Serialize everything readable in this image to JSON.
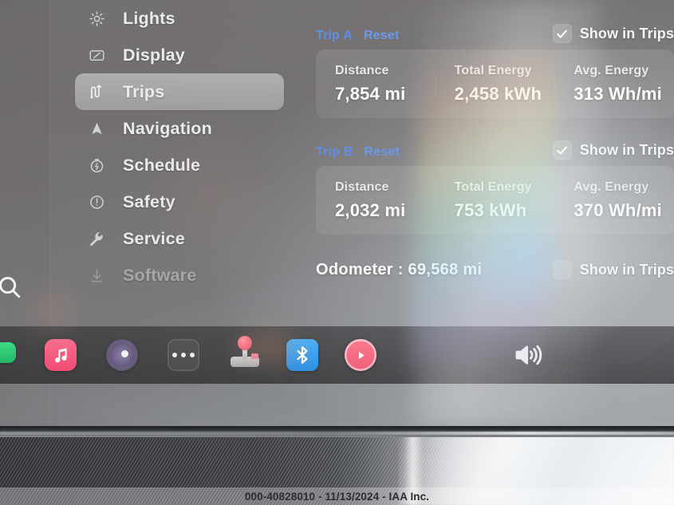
{
  "sidebar": {
    "items": [
      {
        "label": "Lights",
        "icon": "lights-icon",
        "state": "normal"
      },
      {
        "label": "Display",
        "icon": "display-icon",
        "state": "normal"
      },
      {
        "label": "Trips",
        "icon": "trips-icon",
        "state": "active"
      },
      {
        "label": "Navigation",
        "icon": "navigation-icon",
        "state": "normal"
      },
      {
        "label": "Schedule",
        "icon": "schedule-icon",
        "state": "normal"
      },
      {
        "label": "Safety",
        "icon": "safety-icon",
        "state": "normal"
      },
      {
        "label": "Service",
        "icon": "service-icon",
        "state": "normal"
      },
      {
        "label": "Software",
        "icon": "software-icon",
        "state": "dim"
      }
    ]
  },
  "content": {
    "trips": [
      {
        "name": "Trip A",
        "reset_label": "Reset",
        "show_in_trips_label": "Show in Trips",
        "show_in_trips_checked": true,
        "metrics": [
          {
            "label": "Distance",
            "value": "7,854 mi"
          },
          {
            "label": "Total Energy",
            "value": "2,458 kWh"
          },
          {
            "label": "Avg. Energy",
            "value": "313 Wh/mi"
          }
        ]
      },
      {
        "name": "Trip B",
        "reset_label": "Reset",
        "show_in_trips_label": "Show in Trips",
        "show_in_trips_checked": true,
        "metrics": [
          {
            "label": "Distance",
            "value": "2,032 mi"
          },
          {
            "label": "Total Energy",
            "value": "753 kWh"
          },
          {
            "label": "Avg. Energy",
            "value": "370 Wh/mi"
          }
        ]
      }
    ],
    "odometer": {
      "text": "Odometer : 69,568 mi",
      "show_in_trips_label": "Show in Trips",
      "show_in_trips_checked": false
    }
  },
  "dock": {
    "items": [
      {
        "name": "green-app-icon",
        "label": ""
      },
      {
        "name": "music-icon",
        "label": ""
      },
      {
        "name": "media-disc-icon",
        "label": ""
      },
      {
        "name": "more-options-icon",
        "label": ""
      },
      {
        "name": "arcade-icon",
        "label": ""
      },
      {
        "name": "bluetooth-icon",
        "label": ""
      },
      {
        "name": "play-icon",
        "label": ""
      },
      {
        "name": "volume-icon",
        "label": ""
      }
    ]
  },
  "search": {
    "icon": "search-icon"
  },
  "watermark": {
    "text": "000-40828010 - 11/13/2024 - IAA Inc."
  },
  "colors": {
    "accent_blue": "#5d8fe8",
    "bluetooth_blue": "#2f90e2",
    "music_pink": "#f04c74",
    "play_pink": "#ef5e78",
    "text_primary": "#ffffff",
    "screen_bg": "#77787a"
  }
}
